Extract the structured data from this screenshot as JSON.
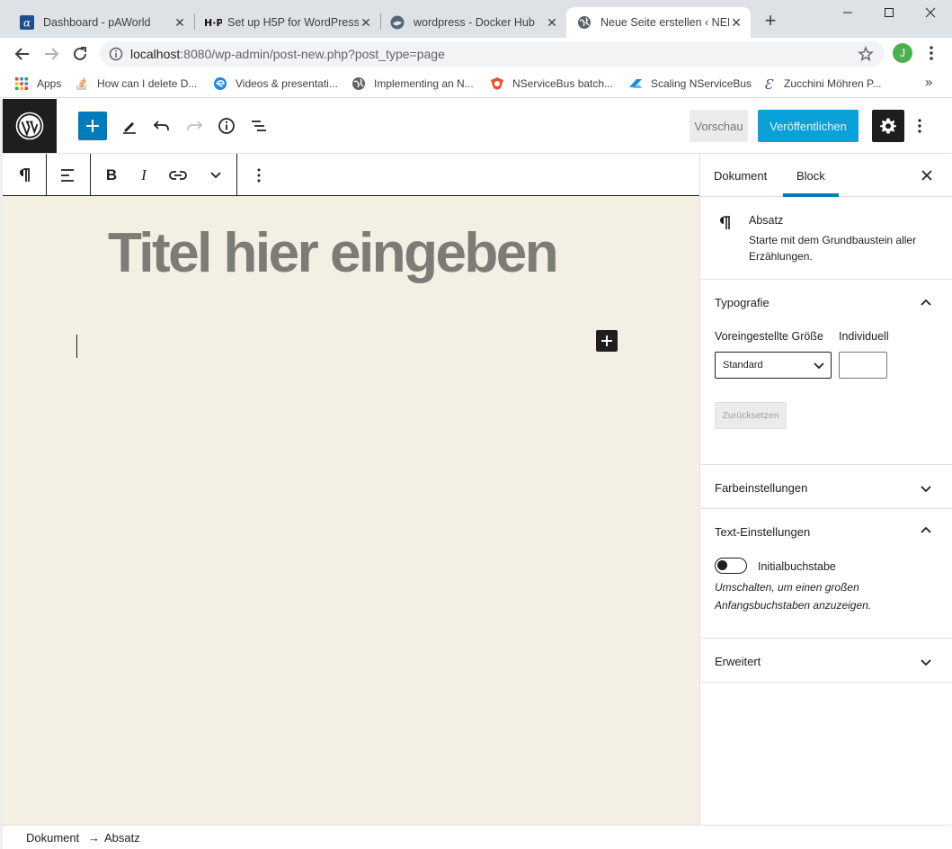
{
  "browser": {
    "tabs": [
      {
        "title": "Dashboard - pAWorld",
        "icon": "alpha-icon",
        "active": false
      },
      {
        "title": "Set up H5P for WordPress",
        "icon": "h5p-icon",
        "active": false
      },
      {
        "title": "wordpress - Docker Hub",
        "icon": "docker-icon",
        "active": false
      },
      {
        "title": "Neue Seite erstellen ‹ NEM",
        "icon": "globe-icon",
        "active": true
      }
    ],
    "new_tab": "+",
    "url_host": "localhost",
    "url_rest": ":8080/wp-admin/post-new.php?post_type=page",
    "avatar_letter": "J",
    "bookmarks": [
      {
        "label": "Apps",
        "icon": "apps-grid-icon"
      },
      {
        "label": "How can I delete D...",
        "icon": "stackoverflow-icon"
      },
      {
        "label": "Videos & presentati...",
        "icon": "edge-icon"
      },
      {
        "label": "Implementing an N...",
        "icon": "globe-icon"
      },
      {
        "label": "NServiceBus batch...",
        "icon": "nservicebus-icon"
      },
      {
        "label": "Scaling NServiceBus",
        "icon": "azure-icon"
      },
      {
        "label": "Zucchini Möhren P...",
        "icon": "chefkoch-icon"
      }
    ],
    "bookmarks_more": "»"
  },
  "editor": {
    "preview_label": "Vorschau",
    "publish_label": "Veröffentlichen",
    "title_placeholder": "Titel hier eingeben"
  },
  "sidebar": {
    "tabs": [
      {
        "label": "Dokument"
      },
      {
        "label": "Block"
      }
    ],
    "active_tab": "Block",
    "block": {
      "name": "Absatz",
      "description": "Starte mit dem Grundbaustein aller Erzählungen."
    },
    "typography": {
      "title": "Typografie",
      "preset_label": "Voreingestellte Größe",
      "custom_label": "Individuell",
      "preset_value": "Standard",
      "custom_value": "",
      "reset_label": "Zurücksetzen"
    },
    "color": {
      "title": "Farbeinstellungen"
    },
    "text": {
      "title": "Text-Einstellungen",
      "dropcap_label": "Initialbuchstabe",
      "dropcap_enabled": false,
      "dropcap_help": "Umschalten, um einen großen Anfangsbuchstaben anzuzeigen."
    },
    "advanced": {
      "title": "Erweitert"
    }
  },
  "breadcrumb": {
    "root": "Dokument",
    "separator": "→",
    "current": "Absatz"
  },
  "colors": {
    "accent": "#007cba",
    "publish": "#0aa0d8",
    "canvas": "#f3efe3",
    "title_placeholder": "#7d7b75"
  }
}
